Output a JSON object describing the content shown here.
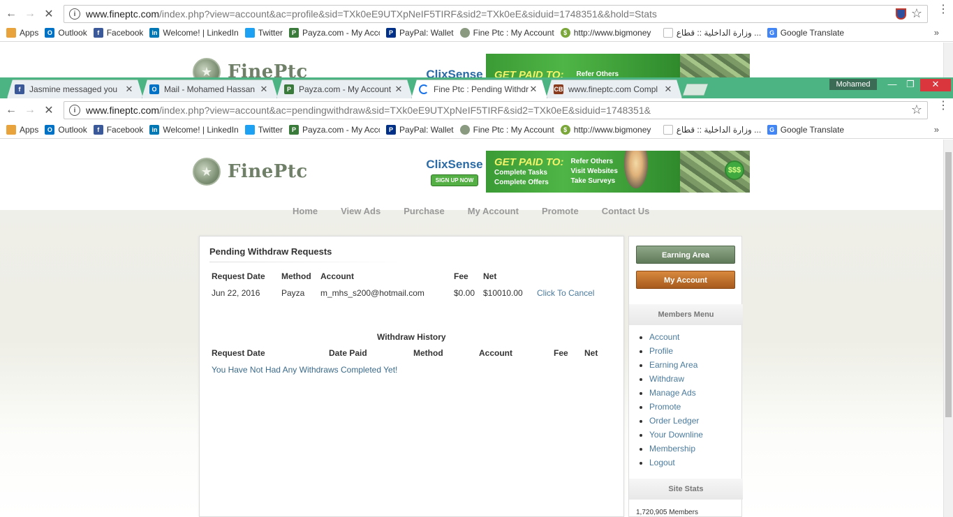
{
  "back_window": {
    "url_host": "www.fineptc.com",
    "url_path": "/index.php?view=account&ac=profile&sid=TXk0eE9UTXpNeIF5TIRF&sid2=TXk0eE&siduid=1748351&&hold=Stats",
    "bookmarks": [
      "Apps",
      "Outlook",
      "Facebook",
      "Welcome! | LinkedIn",
      "Twitter",
      "Payza.com - My Acco",
      "PayPal: Wallet",
      "Fine Ptc : My Account",
      "http://www.bigmoney",
      "وزارة الداخلية :: قطاع ...",
      "Google Translate"
    ]
  },
  "tabs": [
    {
      "label": "Jasmine messaged you",
      "icon": "facebook-icon",
      "color": "#3b5998"
    },
    {
      "label": "Mail - Mohamed Hassan",
      "icon": "outlook-icon",
      "color": "#0072c6"
    },
    {
      "label": "Payza.com - My Account",
      "icon": "payza-icon",
      "color": "#3a7a3a"
    },
    {
      "label": "Fine Ptc : Pending Withdr",
      "icon": "loading-icon",
      "color": "#1a73e8"
    },
    {
      "label": "www.fineptc.com Compl",
      "icon": "cb-icon",
      "color": "#8a3b1e"
    }
  ],
  "profile_name": "Mohamed",
  "omnibox": {
    "host": "www.fineptc.com",
    "path": "/index.php?view=account&ac=pendingwithdraw&sid=TXk0eE9UTXpNeIF5TIRF&sid2=TXk0eE&siduid=1748351&"
  },
  "bookmarks": [
    {
      "label": "Apps",
      "icon": "apps-icon",
      "color": "#e8a33c"
    },
    {
      "label": "Outlook",
      "icon": "outlook-icon",
      "color": "#0072c6"
    },
    {
      "label": "Facebook",
      "icon": "facebook-icon",
      "color": "#3b5998"
    },
    {
      "label": "Welcome! | LinkedIn",
      "icon": "linkedin-icon",
      "color": "#0077b5"
    },
    {
      "label": "Twitter",
      "icon": "twitter-icon",
      "color": "#1da1f2"
    },
    {
      "label": "Payza.com - My Acco",
      "icon": "payza-icon",
      "color": "#3a7a3a"
    },
    {
      "label": "PayPal: Wallet",
      "icon": "paypal-icon",
      "color": "#003087"
    },
    {
      "label": "Fine Ptc : My Account",
      "icon": "fineptc-icon",
      "color": "#8a9a80"
    },
    {
      "label": "http://www.bigmoney",
      "icon": "dollar-icon",
      "color": "#7aa63a"
    },
    {
      "label": "وزارة الداخلية :: قطاع ...",
      "icon": "page-icon",
      "color": "#cccccc"
    },
    {
      "label": "Google Translate",
      "icon": "translate-icon",
      "color": "#4285f4"
    }
  ],
  "site": {
    "logo_text": "FinePtc",
    "banner": {
      "brand": "ClixSense",
      "signup": "SIGN UP NOW",
      "headline": "GET PAID TO:",
      "col1": [
        "Complete Tasks",
        "Complete Offers"
      ],
      "col2": [
        "Refer Others",
        "Visit Websites",
        "Take Surveys"
      ]
    },
    "nav": [
      "Home",
      "View Ads",
      "Purchase",
      "My Account",
      "Promote",
      "Contact Us"
    ]
  },
  "pending": {
    "title": "Pending Withdraw Requests",
    "headers": [
      "Request Date",
      "Method",
      "Account",
      "Fee",
      "Net"
    ],
    "row": {
      "date": "Jun 22, 2016",
      "method": "Payza",
      "account": "m_mhs_s200@hotmail.com",
      "fee": "$0.00",
      "net": "$10010.00",
      "action": "Click To Cancel"
    }
  },
  "history": {
    "title": "Withdraw History",
    "headers": [
      "Request Date",
      "Date Paid",
      "Method",
      "Account",
      "Fee",
      "Net"
    ],
    "empty": "You Have Not Had Any Withdraws Completed Yet!"
  },
  "sidebar": {
    "earning_button": "Earning Area",
    "account_button": "My Account",
    "members_menu_title": "Members Menu",
    "menu": [
      "Account",
      "Profile",
      "Earning Area",
      "Withdraw",
      "Manage Ads",
      "Promote",
      "Order Ledger",
      "Your Downline",
      "Membership",
      "Logout"
    ],
    "stats_title": "Site Stats",
    "members_count": "1,720,905 Members"
  }
}
